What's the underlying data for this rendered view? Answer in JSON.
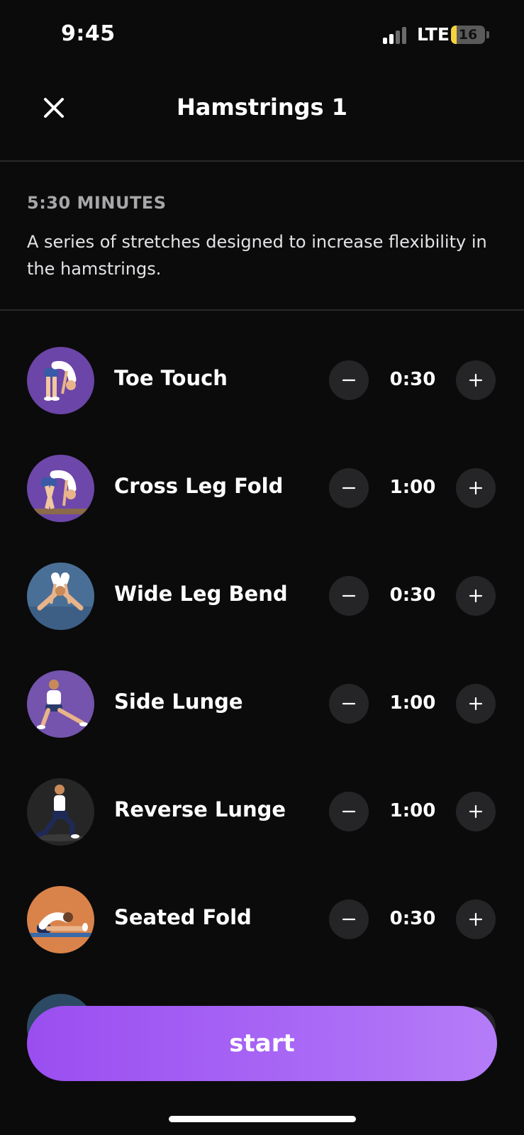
{
  "status_bar": {
    "time": "9:45",
    "carrier": "LTE",
    "battery": "16",
    "battery_level": 0.16
  },
  "header": {
    "title": "Hamstrings 1",
    "close_icon": "close-icon"
  },
  "summary": {
    "duration": "5:30 MINUTES",
    "description": "A series of stretches designed to increase flexibility in the hamstrings."
  },
  "exercises": [
    {
      "name": "Toe Touch",
      "time": "0:30",
      "bg": "#6b45a8",
      "icon": "toe-touch-icon"
    },
    {
      "name": "Cross Leg Fold",
      "time": "1:00",
      "bg": "#6d48aa",
      "icon": "cross-leg-fold-icon"
    },
    {
      "name": "Wide Leg Bend",
      "time": "0:30",
      "bg": "#4a6f97",
      "icon": "wide-leg-bend-icon"
    },
    {
      "name": "Side Lunge",
      "time": "1:00",
      "bg": "#7454ad",
      "icon": "side-lunge-icon"
    },
    {
      "name": "Reverse Lunge",
      "time": "1:00",
      "bg": "#262626",
      "icon": "reverse-lunge-icon"
    },
    {
      "name": "Seated Fold",
      "time": "0:30",
      "bg": "#d9834a",
      "icon": "seated-fold-icon"
    }
  ],
  "actions": {
    "start": "start"
  },
  "colors": {
    "accent": "#a866f5",
    "button_bg": "#252527",
    "background": "#0b0b0c"
  }
}
